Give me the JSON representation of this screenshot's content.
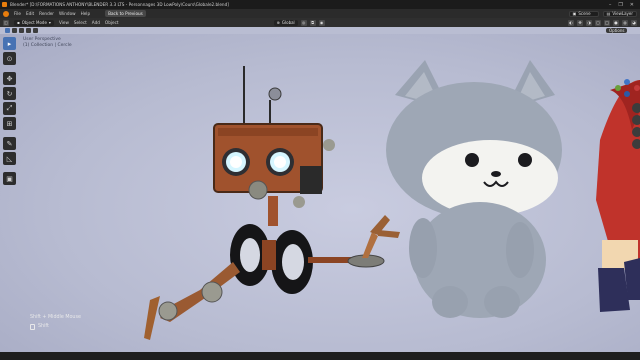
{
  "window": {
    "title": "Blender* [D:\\FORMATIONS ANTHONY\\BLENDER 3.3 LTS - Personnages 3D LowPoly\\Cours\\Globale2.blend]",
    "controls": [
      "–",
      "❐",
      "✕"
    ]
  },
  "menubar": {
    "items": [
      "File",
      "Edit",
      "Render",
      "Window",
      "Help"
    ],
    "tabs": [
      {
        "label": "Back to Previous",
        "active": true
      }
    ],
    "scene_label": "Scene",
    "viewlayer_label": "ViewLayer"
  },
  "header": {
    "mode": "Object Mode",
    "items": [
      "View",
      "Select",
      "Add",
      "Object"
    ],
    "transform": "Global",
    "options_label": "Options"
  },
  "viewport_info": {
    "line1": "User Perspective",
    "line2": "(1) Collection | Cercle"
  },
  "hint": {
    "line1": "Shift + Middle Mouse",
    "line2": "Shift"
  },
  "colors": {
    "accent": "#4772b3",
    "blender_orange": "#e87d0d",
    "viewport_bg": "#b9bdd2"
  },
  "icons": {
    "tools": [
      "select-box-icon",
      "cursor-icon",
      "move-icon",
      "rotate-icon",
      "scale-icon",
      "transform-icon",
      "annotate-icon",
      "measure-icon",
      "add-cube-icon"
    ]
  }
}
